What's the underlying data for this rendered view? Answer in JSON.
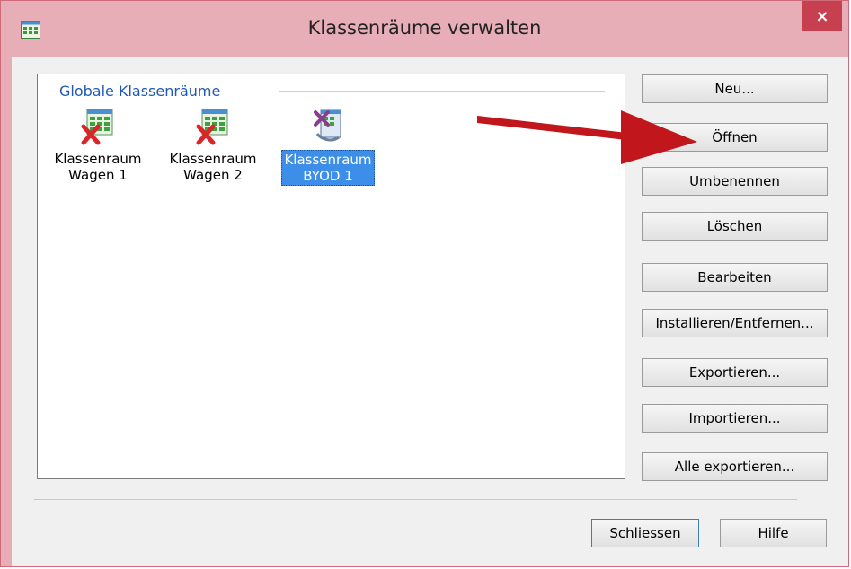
{
  "window": {
    "title": "Klassenräume verwalten",
    "close_label": "×",
    "titlebar_color": "#e8aeb7",
    "close_color": "#c7404f"
  },
  "group": {
    "title": "Globale Klassenräume",
    "rooms": [
      {
        "label_line1": "Klassenraum",
        "label_line2": "Wagen 1",
        "icon": "classroom-error-icon",
        "selected": false
      },
      {
        "label_line1": "Klassenraum",
        "label_line2": "Wagen 2",
        "icon": "classroom-error-icon",
        "selected": false
      },
      {
        "label_line1": "Klassenraum",
        "label_line2": "BYOD 1",
        "icon": "classroom-byod-icon",
        "selected": true
      }
    ]
  },
  "buttons": {
    "neu": "Neu...",
    "oeffnen": "Öffnen",
    "umbenennen": "Umbenennen",
    "loeschen": "Löschen",
    "bearbeiten": "Bearbeiten",
    "installieren": "Installieren/Entfernen...",
    "exportieren": "Exportieren...",
    "importieren": "Importieren...",
    "alle_exportieren": "Alle exportieren..."
  },
  "footer": {
    "schliessen": "Schliessen",
    "hilfe": "Hilfe"
  },
  "annotation": {
    "arrow_color": "#c0161c",
    "icon": "red-arrow-icon"
  }
}
